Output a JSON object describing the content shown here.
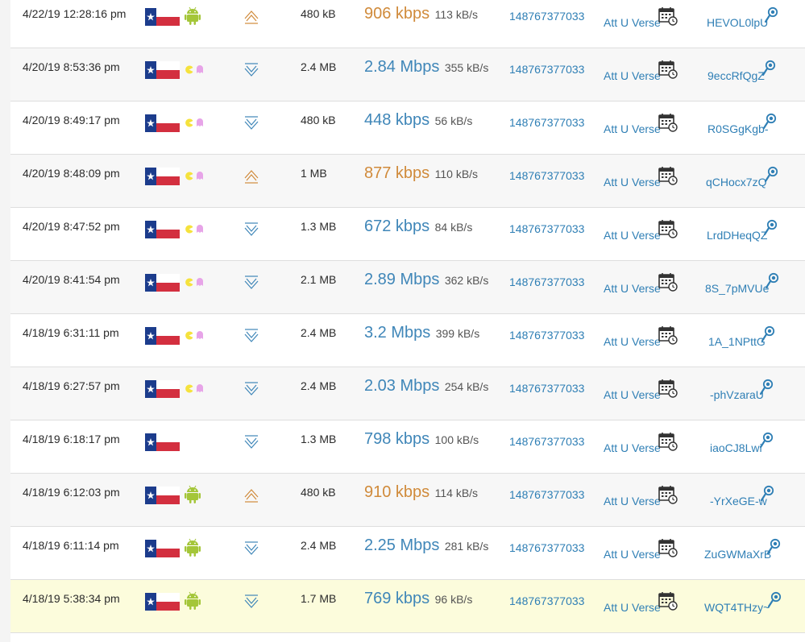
{
  "colors": {
    "upload": "#d08a3a",
    "download": "#3f86b8",
    "link": "#2f7fb5",
    "highlight_row": "#fcfcdc",
    "android": "#a4c639",
    "pacman": "#f5e23c",
    "ghost": "#e7a4e8"
  },
  "icons": {
    "flag": "texas-flag-icon",
    "android": "android-icon",
    "pacman": "pacman-icon",
    "ghost": "ghost-icon",
    "upload": "upload-arrow-icon",
    "download": "download-arrow-icon",
    "calendar": "calendar-clock-icon",
    "details": "magnifier-icon"
  },
  "rows": [
    {
      "datetime": "4/22/19 12:28:16 pm",
      "client": "android",
      "direction": "upload",
      "size": "480 kB",
      "speed": "906 kbps",
      "rate": "113 kB/s",
      "account": "148767377033",
      "isp": "Att U Verse",
      "id": "HEVOL0lpU"
    },
    {
      "datetime": "4/20/19 8:53:36 pm",
      "client": "pacman",
      "direction": "download",
      "size": "2.4 MB",
      "speed": "2.84 Mbps",
      "rate": "355 kB/s",
      "account": "148767377033",
      "isp": "Att U Verse",
      "id": "9eccRfQgZ"
    },
    {
      "datetime": "4/20/19 8:49:17 pm",
      "client": "pacman",
      "direction": "download",
      "size": "480 kB",
      "speed": "448 kbps",
      "rate": "56 kB/s",
      "account": "148767377033",
      "isp": "Att U Verse",
      "id": "R0SGgKgb-"
    },
    {
      "datetime": "4/20/19 8:48:09 pm",
      "client": "pacman",
      "direction": "upload",
      "size": "1 MB",
      "speed": "877 kbps",
      "rate": "110 kB/s",
      "account": "148767377033",
      "isp": "Att U Verse",
      "id": "qCHocx7zQ"
    },
    {
      "datetime": "4/20/19 8:47:52 pm",
      "client": "pacman",
      "direction": "download",
      "size": "1.3 MB",
      "speed": "672 kbps",
      "rate": "84 kB/s",
      "account": "148767377033",
      "isp": "Att U Verse",
      "id": "LrdDHeqQZ"
    },
    {
      "datetime": "4/20/19 8:41:54 pm",
      "client": "pacman",
      "direction": "download",
      "size": "2.1 MB",
      "speed": "2.89 Mbps",
      "rate": "362 kB/s",
      "account": "148767377033",
      "isp": "Att U Verse",
      "id": "8S_7pMVUe"
    },
    {
      "datetime": "4/18/19 6:31:11 pm",
      "client": "pacman",
      "direction": "download",
      "size": "2.4 MB",
      "speed": "3.2 Mbps",
      "rate": "399 kB/s",
      "account": "148767377033",
      "isp": "Att U Verse",
      "id": "1A_1NPttG"
    },
    {
      "datetime": "4/18/19 6:27:57 pm",
      "client": "pacman",
      "direction": "download",
      "size": "2.4 MB",
      "speed": "2.03 Mbps",
      "rate": "254 kB/s",
      "account": "148767377033",
      "isp": "Att U Verse",
      "id": "-phVzaraU"
    },
    {
      "datetime": "4/18/19 6:18:17 pm",
      "client": "none",
      "direction": "download",
      "size": "1.3 MB",
      "speed": "798 kbps",
      "rate": "100 kB/s",
      "account": "148767377033",
      "isp": "Att U Verse",
      "id": "iaoCJ8Lwi"
    },
    {
      "datetime": "4/18/19 6:12:03 pm",
      "client": "android",
      "direction": "upload",
      "size": "480 kB",
      "speed": "910 kbps",
      "rate": "114 kB/s",
      "account": "148767377033",
      "isp": "Att U Verse",
      "id": "-YrXeGE-w"
    },
    {
      "datetime": "4/18/19 6:11:14 pm",
      "client": "android",
      "direction": "download",
      "size": "2.4 MB",
      "speed": "2.25 Mbps",
      "rate": "281 kB/s",
      "account": "148767377033",
      "isp": "Att U Verse",
      "id": "ZuGWMaXrB"
    },
    {
      "datetime": "4/18/19 5:38:34 pm",
      "client": "android",
      "direction": "download",
      "size": "1.7 MB",
      "speed": "769 kbps",
      "rate": "96 kB/s",
      "account": "148767377033",
      "isp": "Att U Verse",
      "id": "WQT4THzy~"
    }
  ]
}
